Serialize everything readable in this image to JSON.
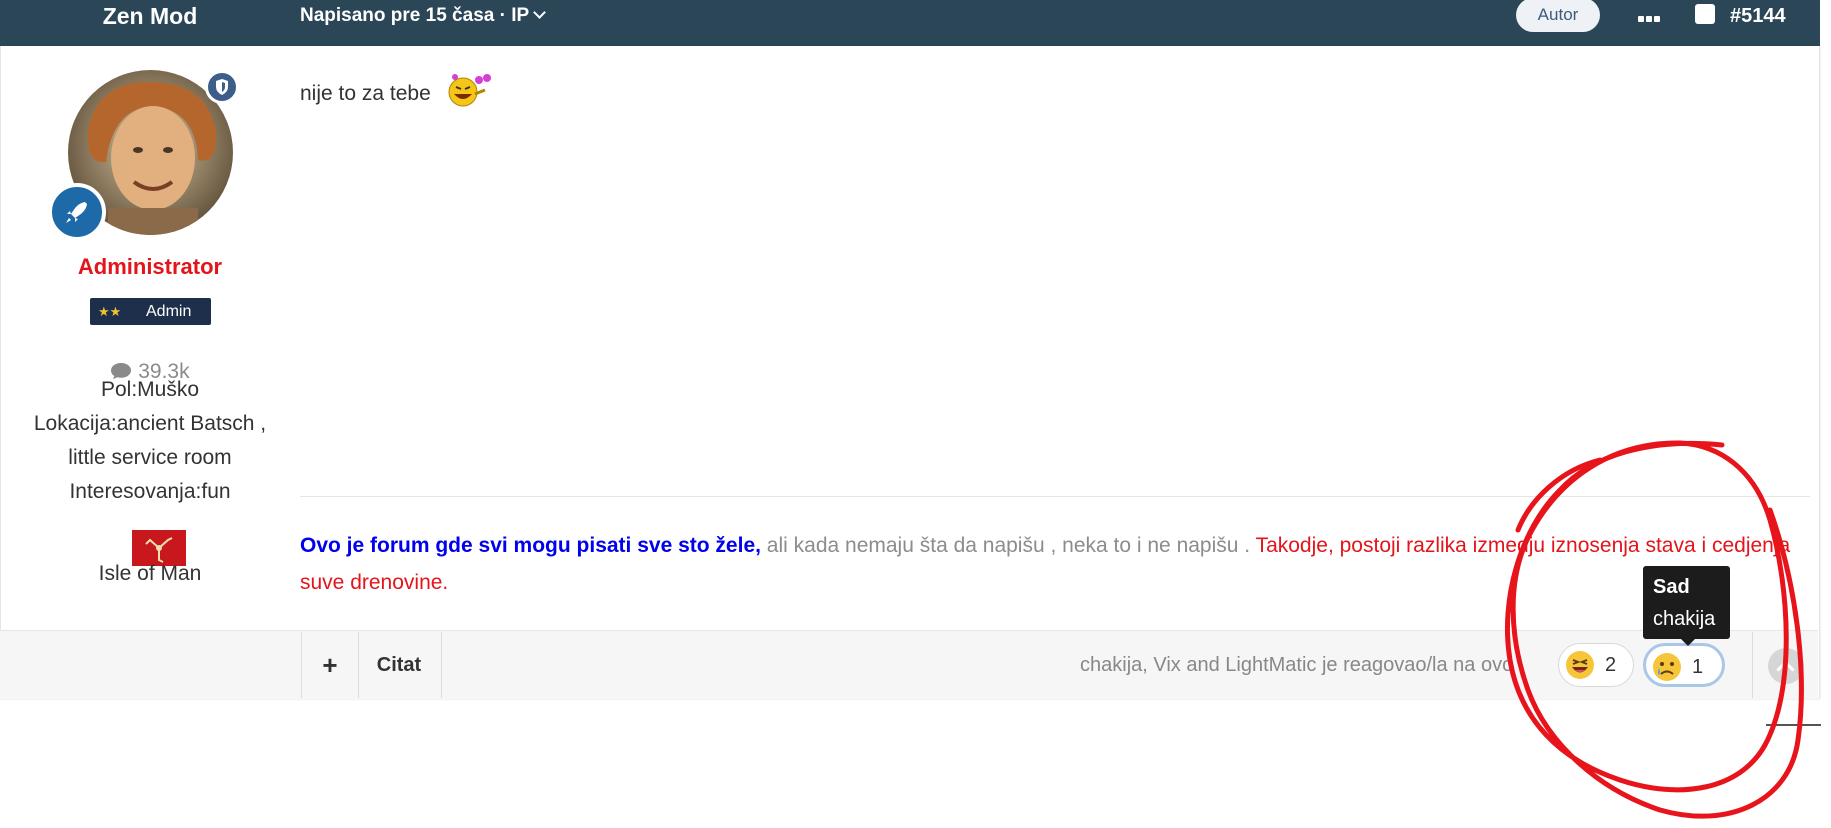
{
  "header": {
    "author_name": "Zen Mod",
    "meta": "Napisano pre 15 časa · IP",
    "author_badge": "Autor",
    "post_number": "#5144"
  },
  "profile": {
    "role": "Administrator",
    "rank": "Admin",
    "post_count": "39.3k",
    "pol": "Pol:Muško",
    "lokacija_line1": "Lokacija:ancient Batsch ,",
    "lokacija_line2": "little service room",
    "interesovanja": "Interesovanja:fun",
    "country": "Isle of Man"
  },
  "post": {
    "text": "nije to za tebe"
  },
  "signature": {
    "part_blue": "Ovo je forum gde svi mogu pisati sve sto žele,",
    "part_gray": " ali kada nemaju šta da napišu , neka to i ne napišu . ",
    "part_red": "Takodje, postoji razlika izmedju iznosenja stava i cedjenja suve drenovine."
  },
  "footer": {
    "plus_label": "+",
    "quote_label": "Citat",
    "reacted_text": "chakija, Vix and LightMatic je reagovao/la na ovo",
    "reactions": [
      {
        "emoji": "laughing-face",
        "count": "2"
      },
      {
        "emoji": "sad-face",
        "count": "1"
      }
    ]
  },
  "tooltip": {
    "title": "Sad",
    "user": "chakija"
  },
  "colors": {
    "header_bg": "#2b4656",
    "role_red": "#e4141b",
    "sig_blue": "#0000ee",
    "annotation_red": "#e8141b"
  }
}
